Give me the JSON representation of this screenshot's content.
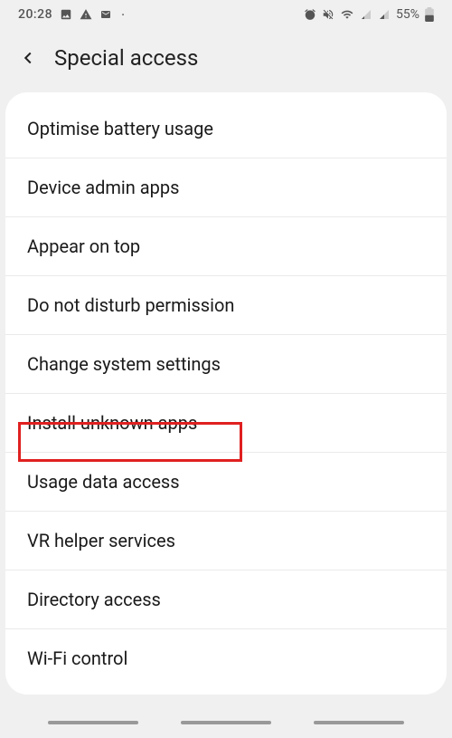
{
  "status": {
    "time": "20:28",
    "battery": "55%"
  },
  "header": {
    "title": "Special access"
  },
  "items": [
    {
      "label": "Optimise battery usage"
    },
    {
      "label": "Device admin apps"
    },
    {
      "label": "Appear on top"
    },
    {
      "label": "Do not disturb permission"
    },
    {
      "label": "Change system settings"
    },
    {
      "label": "Install unknown apps"
    },
    {
      "label": "Usage data access"
    },
    {
      "label": "VR helper services"
    },
    {
      "label": "Directory access"
    },
    {
      "label": "Wi-Fi control"
    }
  ],
  "highlighted_index": 5
}
